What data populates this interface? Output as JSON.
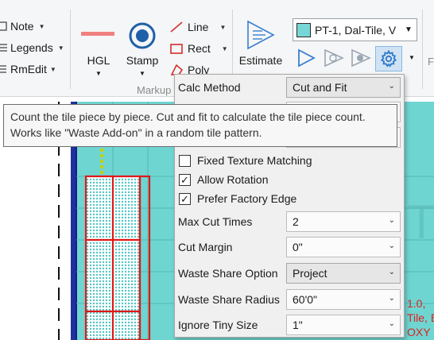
{
  "ribbon": {
    "note_label": "Note",
    "legends_label": "Legends",
    "rmedit_label": "RmEdit",
    "hgl_label": "HGL",
    "stamp_label": "Stamp",
    "line_label": "Line",
    "rect_label": "Rect",
    "poly_label": "Poly",
    "markup_group": "Markup",
    "estimate_label": "Estimate",
    "material_combo": "PT-1, Dal-Tile, V",
    "material_color": "#76d7d6",
    "partial_label": "F"
  },
  "panel": {
    "calc_method_label": "Calc Method",
    "calc_method_value": "Cut and Fit",
    "fixed_texture_label": "Fixed Texture Matching",
    "fixed_texture_checked": false,
    "allow_rotation_label": "Allow Rotation",
    "allow_rotation_checked": true,
    "prefer_factory_label": "Prefer Factory Edge",
    "prefer_factory_checked": true,
    "max_cut_label": "Max Cut Times",
    "max_cut_value": "2",
    "cut_margin_label": "Cut Margin",
    "cut_margin_value": "0\"",
    "waste_option_label": "Waste Share Option",
    "waste_option_value": "Project",
    "waste_radius_label": "Waste Share Radius",
    "waste_radius_value": "60'0\"",
    "ignore_tiny_label": "Ignore Tiny Size",
    "ignore_tiny_value": "1\""
  },
  "tooltip": {
    "line1": "Count the tile piece by piece. Cut and fit to calculate the tile piece count.",
    "line2": "Works like \"Waste Add-on\" in a random tile pattern."
  },
  "canvas": {
    "fragment1": "1.0,",
    "fragment2": "Tile, E",
    "fragment3": "OXY G"
  }
}
